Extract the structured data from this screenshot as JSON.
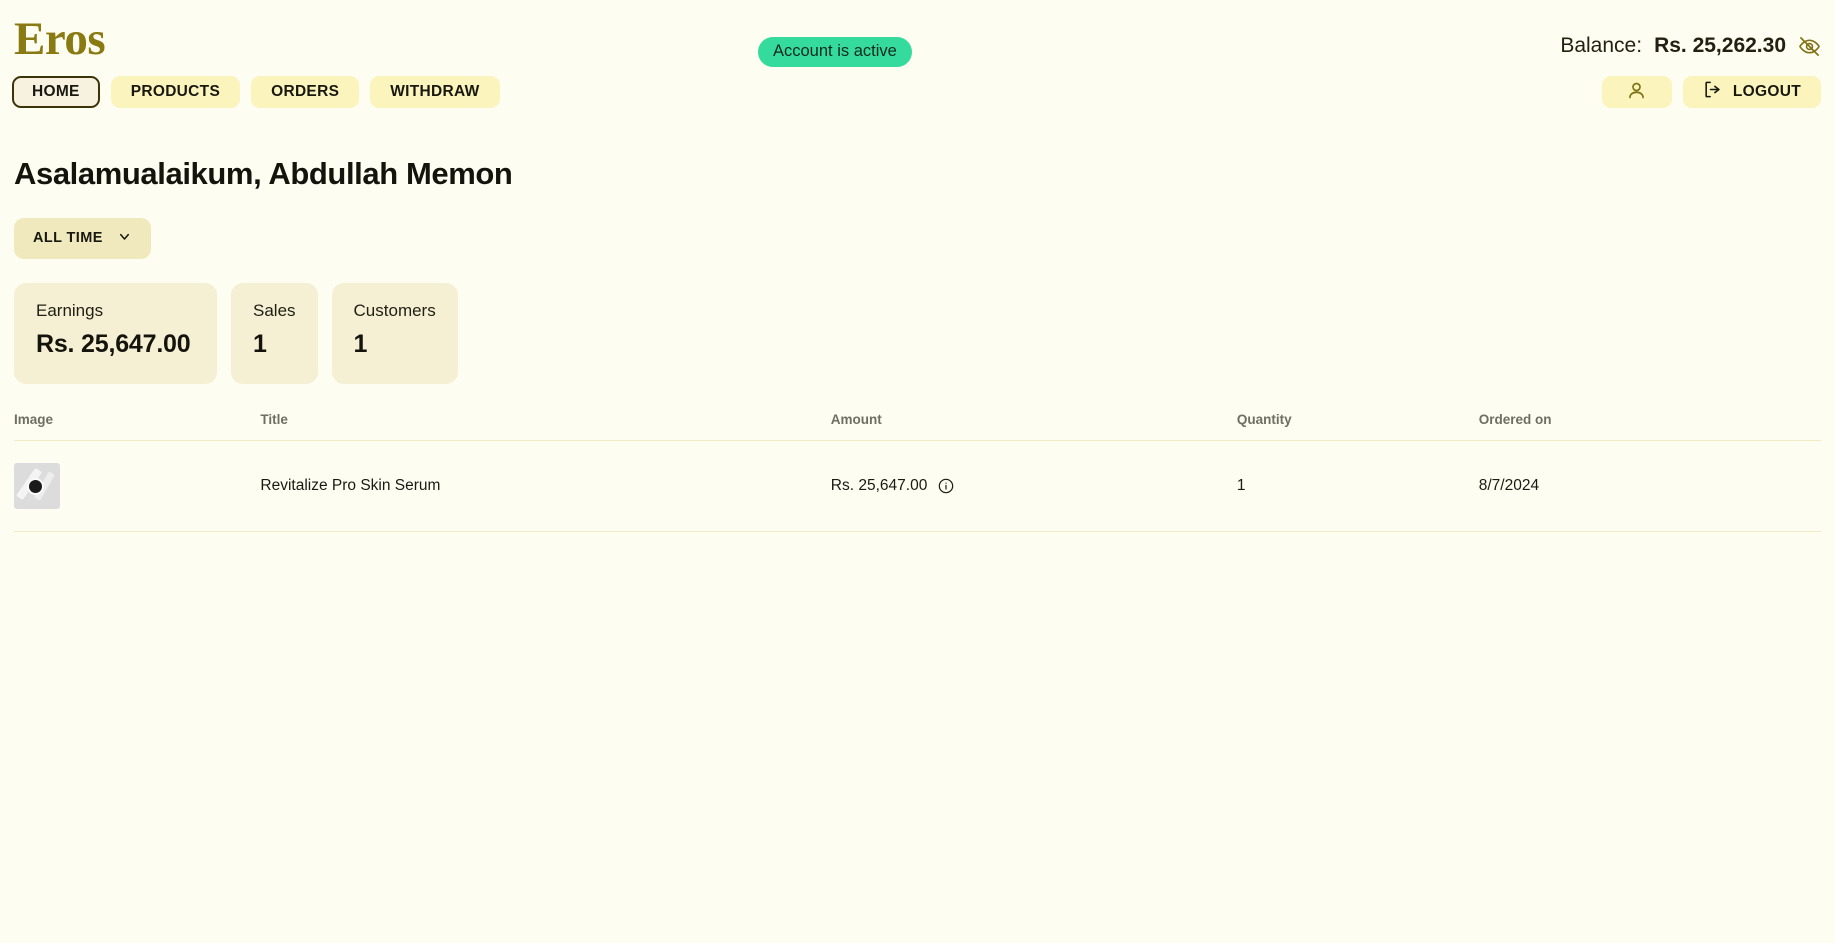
{
  "brand": {
    "name": "Eros",
    "color": "#8A7A12"
  },
  "header": {
    "status_badge": "Account is active",
    "status_badge_color": "#35DB9C",
    "balance_label": "Balance:",
    "balance_value": "Rs. 25,262.30",
    "eye_icon": "eye-off-icon",
    "profile_icon": "user-icon",
    "logout_label": "LOGOUT",
    "logout_icon": "logout-icon"
  },
  "nav": {
    "items": [
      {
        "label": "HOME",
        "active": true
      },
      {
        "label": "PRODUCTS",
        "active": false
      },
      {
        "label": "ORDERS",
        "active": false
      },
      {
        "label": "WITHDRAW",
        "active": false
      }
    ]
  },
  "main": {
    "greeting": "Asalamualaikum, Abdullah Memon",
    "filter": {
      "label": "ALL TIME",
      "icon": "chevron-down-icon"
    },
    "stats": [
      {
        "label": "Earnings",
        "value": "Rs. 25,647.00"
      },
      {
        "label": "Sales",
        "value": "1"
      },
      {
        "label": "Customers",
        "value": "1"
      }
    ],
    "table": {
      "columns": [
        "Image",
        "Title",
        "Amount",
        "Quantity",
        "Ordered on"
      ],
      "rows": [
        {
          "image": "product-thumbnail",
          "title": "Revitalize Pro Skin Serum",
          "amount": "Rs. 25,647.00",
          "amount_info_icon": "info-icon",
          "quantity": "1",
          "ordered_on": "8/7/2024"
        }
      ]
    }
  }
}
